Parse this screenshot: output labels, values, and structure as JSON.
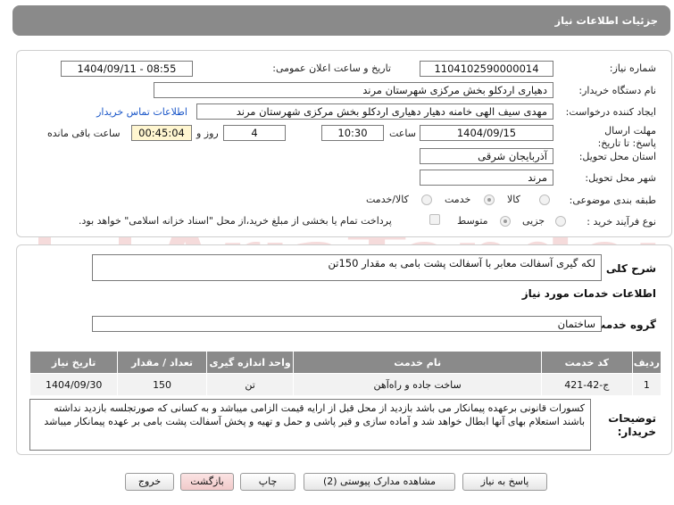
{
  "header": {
    "title": "جزئیات اطلاعات نیاز"
  },
  "form": {
    "need_number_label": "شماره نیاز:",
    "need_number": "1104102590000014",
    "announce_label": "تاریخ و ساعت اعلان عمومی:",
    "announce_value": "1404/09/11 - 08:55",
    "buyer_org_label": "نام دستگاه خریدار:",
    "buyer_org": "دهیاری اردکلو بخش مرکزی شهرستان مرند",
    "requester_label": "ایجاد کننده درخواست:",
    "requester": "مهدی سیف الهی خامنه دهیار دهیاری اردکلو بخش مرکزی شهرستان مرند",
    "contact_link": "اطلاعات تماس خریدار",
    "deadline_label": "مهلت ارسال پاسخ: تا تاریخ:",
    "deadline_date": "1404/09/15",
    "time_label": "ساعت",
    "deadline_time": "10:30",
    "days_value": "4",
    "days_label": "روز و",
    "remaining_time": "00:45:04",
    "remaining_label": "ساعت باقی مانده",
    "province_label": "استان محل تحویل:",
    "province": "آذربایجان شرقی",
    "city_label": "شهر محل تحویل:",
    "city": "مرند",
    "category_label": "طبقه بندی موضوعی:",
    "category_options": [
      "کالا",
      "خدمت",
      "کالا/خدمت"
    ],
    "category_selected": 1,
    "process_label": "نوع فرآیند خرید :",
    "process_options": [
      "جزیی",
      "متوسط"
    ],
    "process_selected": 1,
    "payment_text": "پرداخت تمام یا بخشی از مبلغ خرید،از محل \"اسناد خزانه اسلامی\" خواهد بود."
  },
  "summary": {
    "label": "شرح کلی نیاز:",
    "value": "لکه گیری آسفالت معابر با آسفالت پشت بامی به مقدار 150تن"
  },
  "services": {
    "section_title": "اطلاعات خدمات مورد نیاز",
    "group_label": "گروه خدمت:",
    "group_value": "ساختمان",
    "columns": [
      "ردیف",
      "کد خدمت",
      "نام خدمت",
      "واحد اندازه گیری",
      "تعداد / مقدار",
      "تاریخ نیاز"
    ],
    "rows": [
      [
        "1",
        "ج-42-421",
        "ساخت جاده و راه‌آهن",
        "تن",
        "150",
        "1404/09/30"
      ]
    ]
  },
  "buyer_notes": {
    "label": "توضیحات خریدار:",
    "value": "کسورات قانونی برعهده پیمانکار می باشد بازدید از محل قبل از ارایه قیمت الزامی میباشد و به کسانی که صورتجلسه بازدید نداشته باشند استعلام بهای آنها ابطال خواهد شد و آماده سازی و قیر پاشی و حمل و تهیه و پخش آسفالت پشت بامی بر عهده پیمانکار میباشد"
  },
  "buttons": {
    "reply": "پاسخ به نیاز",
    "view_docs": "مشاهده مدارک پیوستی (2)",
    "print": "چاپ",
    "back": "بازگشت",
    "exit": "خروج"
  },
  "watermark": {
    "text": "AriaTender.net"
  },
  "colors": {
    "header_bg": "#8a8a8a",
    "link": "#1a56c8",
    "timer_bg": "#fff6d0",
    "watermark": "#c62828"
  }
}
